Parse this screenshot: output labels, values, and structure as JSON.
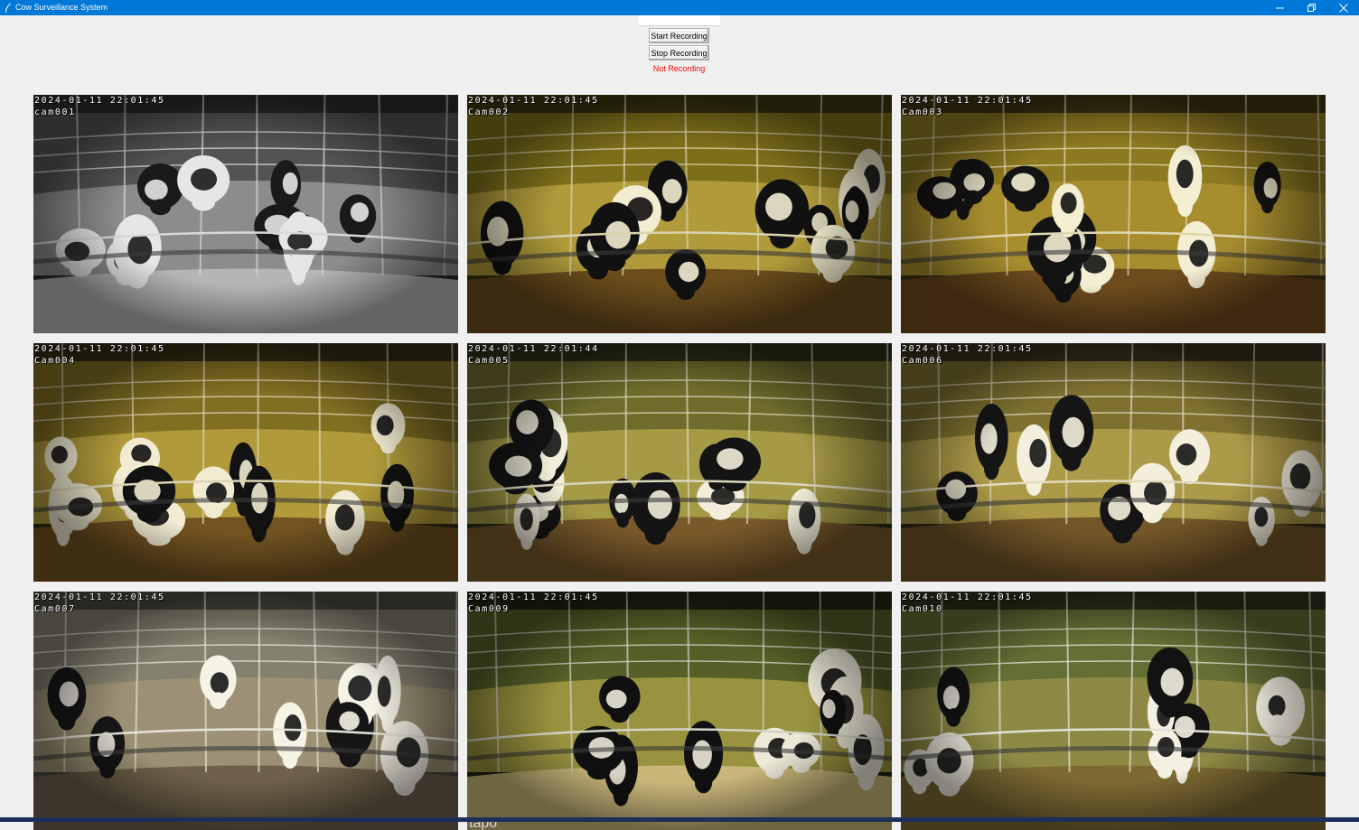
{
  "window": {
    "title": "Cow Surveillance System",
    "accent_color": "#0078d7",
    "icons": [
      "feather-icon",
      "minimize-icon",
      "restore-icon",
      "close-icon"
    ]
  },
  "controls": {
    "entry_value": "",
    "start_label": "Start Recording",
    "stop_label": "Stop Recording",
    "status_text": "Not Recording",
    "status_color": "#ff0000"
  },
  "cameras": [
    {
      "timestamp": "2024-01-11 22:01:45",
      "name": "cam001",
      "mode": "infrared-grayscale"
    },
    {
      "timestamp": "2024-01-11 22:01:45",
      "name": "Cam002",
      "mode": "color"
    },
    {
      "timestamp": "2024-01-11 22:01:45",
      "name": "Cam003",
      "mode": "color"
    },
    {
      "timestamp": "2024-01-11 22:01:45",
      "name": "Cam004",
      "mode": "color"
    },
    {
      "timestamp": "2024-01-11 22:01:44",
      "name": "Cam005",
      "mode": "color"
    },
    {
      "timestamp": "2024-01-11 22:01:45",
      "name": "Cam006",
      "mode": "color"
    },
    {
      "timestamp": "2024-01-11 22:01:45",
      "name": "Cam007",
      "mode": "color"
    },
    {
      "timestamp": "2024-01-11 22:01:45",
      "name": "Cam009",
      "mode": "color",
      "watermark": "tapo"
    },
    {
      "timestamp": "2024-01-11 22:01:45",
      "name": "Cam010",
      "mode": "color"
    }
  ]
}
